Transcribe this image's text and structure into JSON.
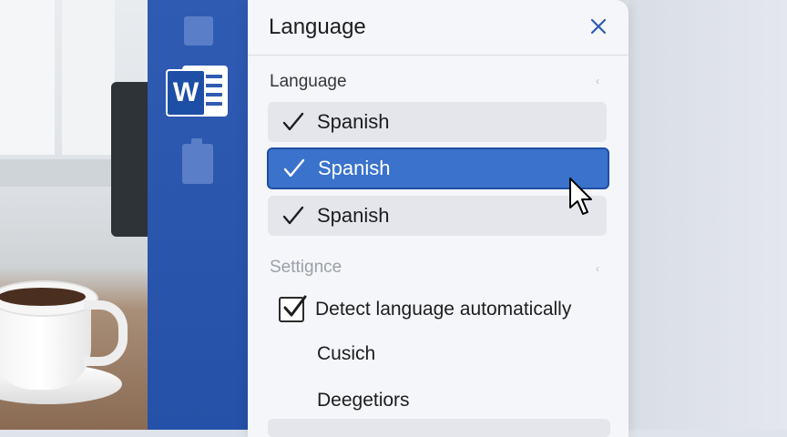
{
  "dialog": {
    "title": "Language",
    "close_icon": "close-icon"
  },
  "language_section": {
    "label": "Language",
    "options": [
      {
        "label": "Spanish",
        "checked": true,
        "selected": false
      },
      {
        "label": "Spanish",
        "checked": true,
        "selected": true
      },
      {
        "label": "Spanish",
        "checked": true,
        "selected": false
      }
    ]
  },
  "settings_section": {
    "label": "Settignce",
    "detect_label": "Detect language automatically",
    "detect_checked": true,
    "items": [
      {
        "label": "Cusich"
      },
      {
        "label": "Deegetiors"
      }
    ]
  },
  "sidebar": {
    "app_logo_letter": "W",
    "app_logo_icon": "word-logo-icon"
  },
  "colors": {
    "accent": "#3a72cc",
    "sidebar": "#2f5bb3",
    "close": "#2f5bb3"
  }
}
